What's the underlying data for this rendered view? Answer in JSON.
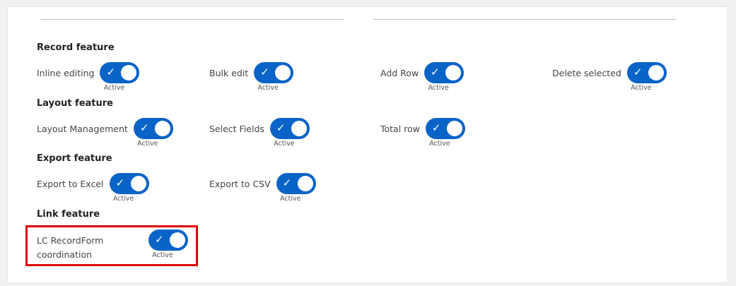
{
  "sections": {
    "record": {
      "title": "Record feature",
      "items": [
        {
          "label": "Inline editing",
          "status": "Active",
          "on": true
        },
        {
          "label": "Bulk edit",
          "status": "Active",
          "on": true
        },
        {
          "label": "Add Row",
          "status": "Active",
          "on": true
        },
        {
          "label": "Delete selected",
          "status": "Active",
          "on": true
        }
      ]
    },
    "layout": {
      "title": "Layout feature",
      "items": [
        {
          "label": "Layout Management",
          "status": "Active",
          "on": true
        },
        {
          "label": "Select Fields",
          "status": "Active",
          "on": true
        },
        {
          "label": "Total row",
          "status": "Active",
          "on": true
        }
      ]
    },
    "export": {
      "title": "Export feature",
      "items": [
        {
          "label": "Export to Excel",
          "status": "Active",
          "on": true
        },
        {
          "label": "Export to CSV",
          "status": "Active",
          "on": true
        }
      ]
    },
    "link": {
      "title": "Link feature",
      "items": [
        {
          "label_line1": "LC RecordForm",
          "label_line2": "coordination",
          "status": "Active",
          "on": true
        }
      ]
    }
  },
  "colors": {
    "toggle_on": "#0a63c7",
    "highlight": "#e00000"
  },
  "icons": {
    "toggle_check": "check-icon"
  }
}
